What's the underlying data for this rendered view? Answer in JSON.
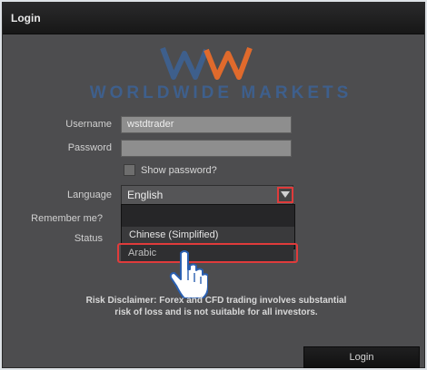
{
  "window": {
    "title": "Login"
  },
  "logo": {
    "mark": "WWM",
    "text": "WORLDWIDE MARKETS"
  },
  "form": {
    "username_label": "Username",
    "username_value": "wstdtrader",
    "password_label": "Password",
    "password_value": "",
    "show_password_label": "Show password?",
    "language_label": "Language",
    "language_selected": "English",
    "remember_label": "Remember me?",
    "status_label": "Status"
  },
  "dropdown": {
    "options": [
      "Chinese (Simplified)",
      "Arabic"
    ]
  },
  "disclaimer": {
    "line1": "Risk Disclaimer: Forex and CFD trading involves substantial",
    "line2": "risk of loss and is not suitable for all investors."
  },
  "buttons": {
    "login": "Login"
  },
  "colors": {
    "logo_orange": "#e06a2c",
    "logo_blue": "#3e5f8c",
    "highlight_red": "#e03b3b"
  }
}
